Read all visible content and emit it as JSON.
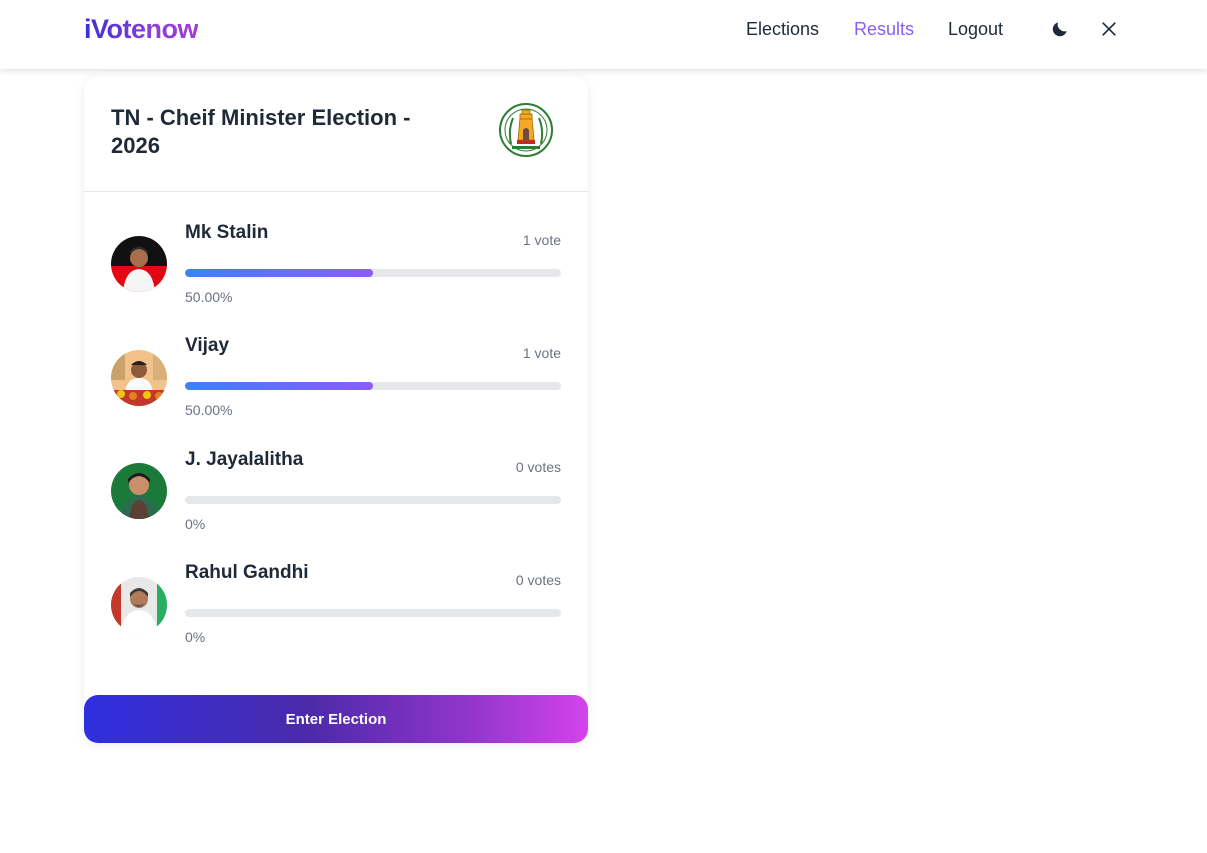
{
  "nav": {
    "logo": "iVotenow",
    "links": [
      {
        "label": "Elections"
      },
      {
        "label": "Results"
      },
      {
        "label": "Logout"
      }
    ],
    "theme_icon": "moon-icon",
    "close_icon": "close-icon",
    "active_color": "#8b5cf6"
  },
  "election": {
    "title": "TN - Cheif Minister Election - 2026",
    "emblem": "tamil-nadu-emblem-icon",
    "candidates": [
      {
        "name": "Mk Stalin",
        "votes": "1 vote",
        "percent_label": "50.00%",
        "share": 0.5
      },
      {
        "name": "Vijay",
        "votes": "1 vote",
        "percent_label": "50.00%",
        "share": 0.5
      },
      {
        "name": "J. Jayalalitha",
        "votes": "0 votes",
        "percent_label": "0%",
        "share": 0
      },
      {
        "name": "Rahul Gandhi",
        "votes": "0 votes",
        "percent_label": "0%",
        "share": 0
      }
    ],
    "action_label": "Enter Election"
  }
}
